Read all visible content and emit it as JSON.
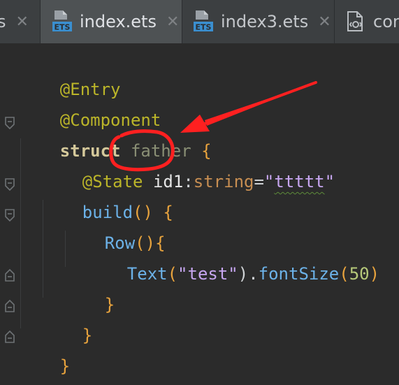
{
  "tabs": [
    {
      "label": "s",
      "close": "✕",
      "active": false
    },
    {
      "label": "index.ets",
      "close": "✕",
      "active": true,
      "icon": "ets-file-icon",
      "icon_text": "ETS"
    },
    {
      "label": "index3.ets",
      "close": "✕",
      "active": false,
      "icon": "ets-file-icon",
      "icon_text": "ETS"
    },
    {
      "label": "con",
      "active": false,
      "icon": "config-file-icon"
    }
  ],
  "code": {
    "line1": {
      "t1": "@Entry"
    },
    "line2": {
      "t1": "@Component"
    },
    "line3": {
      "t1": "struct",
      "t2": " ",
      "t3": "father",
      "t4": " ",
      "t5": "{"
    },
    "line4": {
      "t1": "@State",
      "t2": " ",
      "t3": "id1",
      "t4": ":",
      "t5": "string",
      "t6": "=",
      "t7": "\"",
      "t8": "ttttt",
      "t9": "\""
    },
    "line5": {
      "t1": "build",
      "t2": "()",
      "t3": " ",
      "t4": "{"
    },
    "line6": {
      "t1": "Row",
      "t2": "()",
      "t3": "{"
    },
    "line7": {
      "t1": "Text",
      "t2": "(",
      "t3": "\"test\"",
      "t4": ").",
      "t5": "fontSize",
      "t6": "(",
      "t7": "50",
      "t8": ")"
    },
    "line8": {
      "t1": "}"
    },
    "line9": {
      "t1": "}"
    },
    "line10": {
      "t1": "}"
    }
  },
  "colors": {
    "annotation_red": "#ff2020",
    "editor_bg": "#2b2b2b",
    "tabbar_bg": "#3c3f41",
    "active_tab_bg": "#4e5254"
  }
}
